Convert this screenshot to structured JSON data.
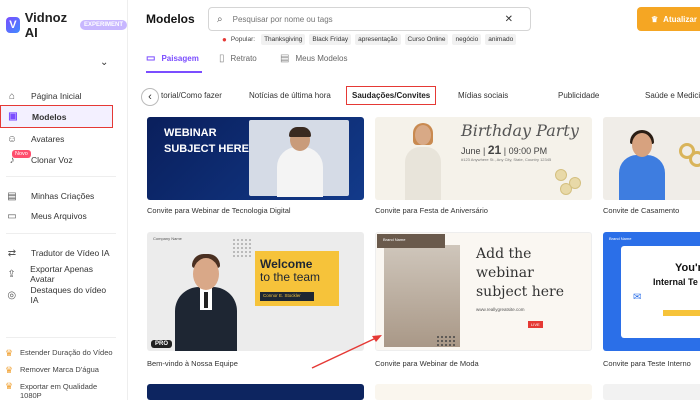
{
  "brand": {
    "name": "Vidnoz AI",
    "badge": "EXPERIMENT"
  },
  "sidebar": {
    "items": [
      {
        "label": "Página Inicial"
      },
      {
        "label": "Modelos"
      },
      {
        "label": "Avatares"
      },
      {
        "label": "Clonar Voz",
        "badge": "Novo"
      },
      {
        "label": "Minhas Criações"
      },
      {
        "label": "Meus Arquivos"
      },
      {
        "label": "Tradutor de Vídeo IA"
      },
      {
        "label": "Exportar Apenas Avatar"
      },
      {
        "label": "Destaques do vídeo IA"
      }
    ],
    "promos": [
      {
        "label": "Estender Duração do Vídeo"
      },
      {
        "label": "Remover Marca D'água"
      },
      {
        "label": "Exportar em Qualidade 1080P"
      }
    ]
  },
  "header": {
    "title": "Modelos",
    "search_placeholder": "Pesquisar por nome ou tags",
    "upgrade_label": "Atualizar"
  },
  "popular": {
    "label": "Popular:",
    "tags": [
      "Thanksgiving",
      "Black Friday",
      "apresentação",
      "Curso Online",
      "negócio",
      "animado"
    ]
  },
  "orientation": {
    "tabs": [
      {
        "label": "Paisagem"
      },
      {
        "label": "Retrato"
      },
      {
        "label": "Meus Modelos"
      }
    ]
  },
  "categories": [
    "torial/Como fazer",
    "Notícias de última hora",
    "Saudações/Convites",
    "Mídias sociais",
    "Publicidade",
    "Saúde e Medicina"
  ],
  "cards": [
    {
      "caption": "Convite para Webinar de Tecnologia Digital",
      "line1": "WEBINAR",
      "line2": "SUBJECT HERE"
    },
    {
      "caption": "Convite para Festa de Aniversário",
      "title": "Birthday Party",
      "month": "June",
      "day": "21",
      "dow": "09:00 PM",
      "addr": "#123 Anywhere St., Any City, State, Country 12345"
    },
    {
      "caption": "Convite de Casamento"
    },
    {
      "caption": "Bem-vindo à Nossa Equipe",
      "line1": "Welcome",
      "line2": "to the team",
      "name": "Connor E. Stockler",
      "pro": "PRO",
      "brand": "Company Name"
    },
    {
      "caption": "Convite para Webinar de Moda",
      "headline": "Add the webinar subject here",
      "brand": "Brand Name",
      "info": "www.reallygreatsite.com",
      "live": "LIVE"
    },
    {
      "caption": "Convite para Teste Interno",
      "line1": "You're",
      "line2": "Internal Te",
      "brand": "Brand Name"
    }
  ]
}
